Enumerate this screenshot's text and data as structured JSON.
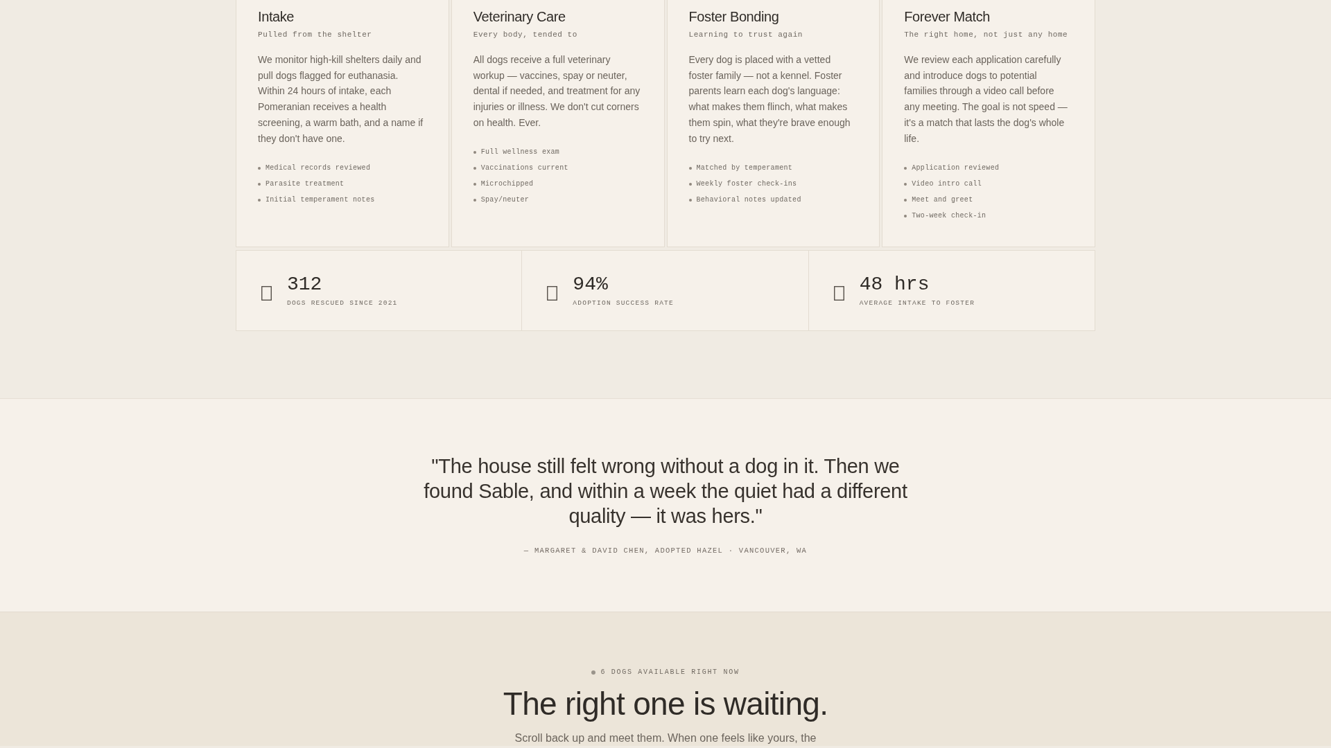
{
  "process_cards": [
    {
      "title": "Intake",
      "subtitle": "Pulled from the shelter",
      "description": "We monitor high-kill shelters daily and pull dogs flagged for euthanasia. Within 24 hours of intake, each Pomeranian receives a health screening, a warm bath, and a name if they don't have one.",
      "checklist": [
        "Medical records reviewed",
        "Parasite treatment",
        "Initial temperament notes"
      ]
    },
    {
      "title": "Veterinary Care",
      "subtitle": "Every body, tended to",
      "description": "All dogs receive a full veterinary workup — vaccines, spay or neuter, dental if needed, and treatment for any injuries or illness. We don't cut corners on health. Ever.",
      "checklist": [
        "Full wellness exam",
        "Vaccinations current",
        "Microchipped",
        "Spay/neuter"
      ]
    },
    {
      "title": "Foster Bonding",
      "subtitle": "Learning to trust again",
      "description": "Every dog is placed with a vetted foster family — not a kennel. Foster parents learn each dog's language: what makes them flinch, what makes them spin, what they're brave enough to try next.",
      "checklist": [
        "Matched by temperament",
        "Weekly foster check-ins",
        "Behavioral notes updated"
      ]
    },
    {
      "title": "Forever Match",
      "subtitle": "The right home, not just any home",
      "description": "We review each application carefully and introduce dogs to potential families through a video call before any meeting. The goal is not speed — it's a match that lasts the dog's whole life.",
      "checklist": [
        "Application reviewed",
        "Video intro call",
        "Meet and greet",
        "Two-week check-in"
      ]
    }
  ],
  "stats": [
    {
      "value": "312",
      "label": "DOGS RESCUED SINCE 2021"
    },
    {
      "value": "94%",
      "label": "ADOPTION SUCCESS RATE"
    },
    {
      "value": "48 hrs",
      "label": "AVERAGE INTAKE TO FOSTER"
    }
  ],
  "testimonial": {
    "quote": "\"The house still felt wrong without a dog in it. Then we found Sable, and within a week the quiet had a different quality — it was hers.\"",
    "attribution": "— MARGARET & DAVID CHEN, ADOPTED HAZEL · VANCOUVER, WA"
  },
  "cta": {
    "badge": "6 DOGS AVAILABLE RIGHT NOW",
    "heading": "The right one is waiting.",
    "text": "Scroll back up and meet them. When one feels like yours, the"
  }
}
